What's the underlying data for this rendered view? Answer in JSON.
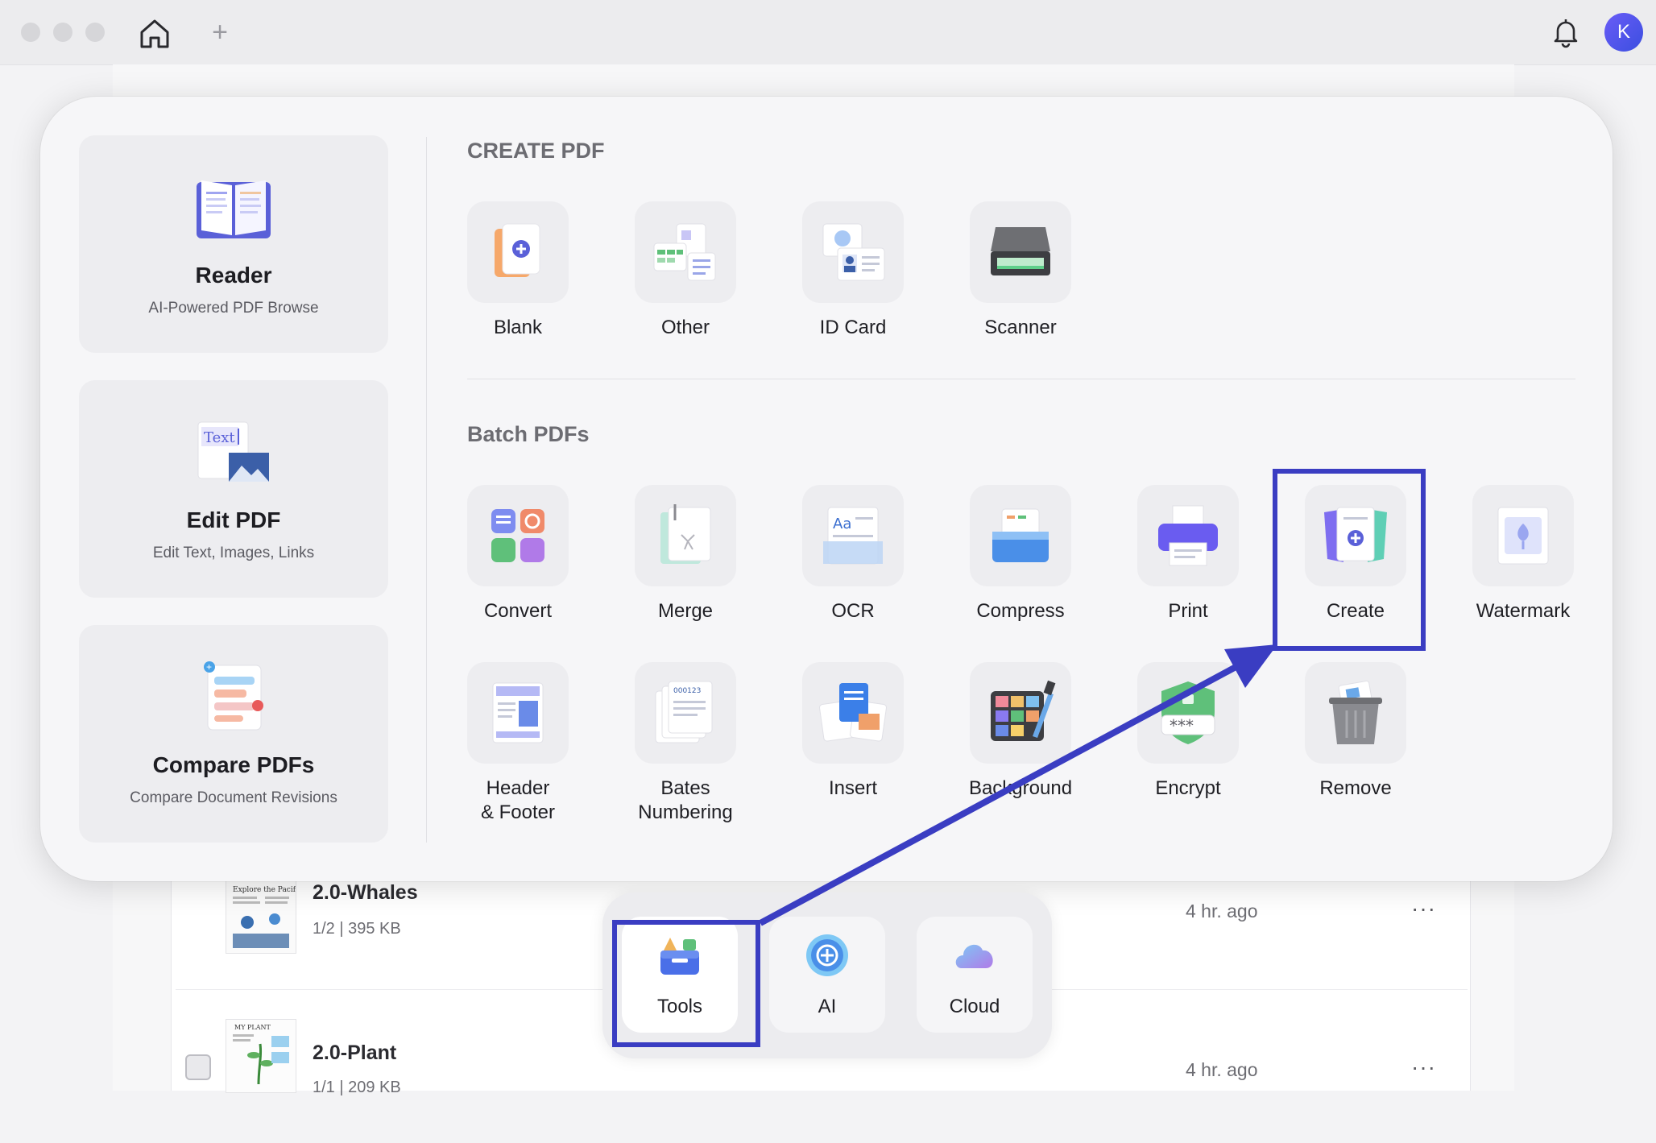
{
  "titlebar": {
    "avatar_initial": "K"
  },
  "popup": {
    "left_cards": [
      {
        "title": "Reader",
        "subtitle": "AI-Powered PDF Browse"
      },
      {
        "title": "Edit PDF",
        "subtitle": "Edit Text, Images, Links",
        "icon_text": "Text"
      },
      {
        "title": "Compare PDFs",
        "subtitle": "Compare Document Revisions"
      }
    ],
    "create_section": {
      "title": "CREATE PDF",
      "tools": [
        {
          "label": "Blank",
          "icon": "blank-page-icon"
        },
        {
          "label": "Other",
          "icon": "other-formats-icon"
        },
        {
          "label": "ID Card",
          "icon": "id-card-icon"
        },
        {
          "label": "Scanner",
          "icon": "scanner-icon"
        }
      ]
    },
    "batch_section": {
      "title": "Batch PDFs",
      "tools": [
        {
          "label": "Convert",
          "icon": "convert-icon"
        },
        {
          "label": "Merge",
          "icon": "merge-icon"
        },
        {
          "label": "OCR",
          "icon": "ocr-icon",
          "icon_text": "Aa"
        },
        {
          "label": "Compress",
          "icon": "compress-icon"
        },
        {
          "label": "Print",
          "icon": "print-icon"
        },
        {
          "label": "Create",
          "icon": "create-icon"
        },
        {
          "label": "Watermark",
          "icon": "watermark-icon"
        },
        {
          "label": "Header\n& Footer",
          "icon": "header-footer-icon"
        },
        {
          "label": "Bates\nNumbering",
          "icon": "bates-numbering-icon",
          "icon_text": "000123"
        },
        {
          "label": "Insert",
          "icon": "insert-icon"
        },
        {
          "label": "Background",
          "icon": "background-icon"
        },
        {
          "label": "Encrypt",
          "icon": "encrypt-icon",
          "icon_text": "***"
        },
        {
          "label": "Remove",
          "icon": "remove-icon"
        }
      ]
    }
  },
  "files": [
    {
      "name": "2.0-Whales",
      "meta": "1/2  |  395 KB",
      "time": "4 hr. ago",
      "more": "···"
    },
    {
      "name": "2.0-Plant",
      "meta": "1/1  |  209 KB",
      "time": "4 hr. ago",
      "more": "···"
    }
  ],
  "dock": {
    "items": [
      {
        "label": "Tools",
        "icon": "tools-icon",
        "active": true
      },
      {
        "label": "AI",
        "icon": "ai-icon",
        "active": false
      },
      {
        "label": "Cloud",
        "icon": "cloud-icon",
        "active": false
      }
    ]
  },
  "colors": {
    "highlight": "#3a3dc2",
    "accent": "#6a5cf7"
  }
}
